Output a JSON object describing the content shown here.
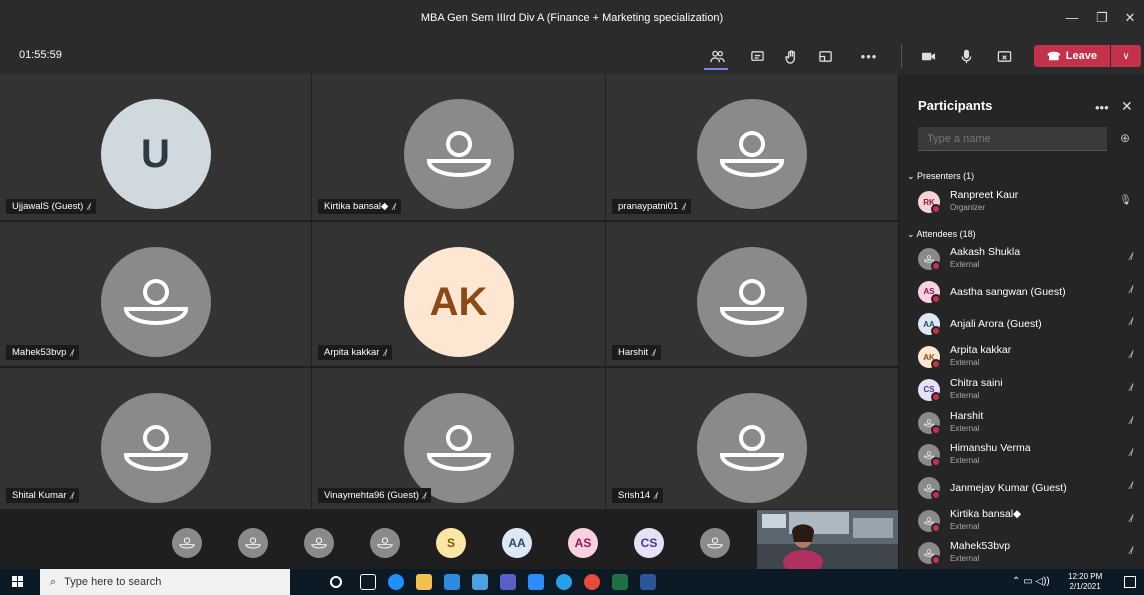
{
  "window": {
    "title": "MBA Gen Sem IIIrd Div A (Finance + Marketing specialization)"
  },
  "toolbar": {
    "timer": "01:55:59",
    "leave_label": "Leave"
  },
  "tiles": [
    {
      "name": "UjjawalS (Guest)",
      "initials": "U",
      "bg": "#cfd9de",
      "fg": "#2b3a44"
    },
    {
      "name": "Kirtika bansal◆",
      "initials": "",
      "bg": "",
      "fg": ""
    },
    {
      "name": "pranaypatni01",
      "initials": "",
      "bg": "",
      "fg": ""
    },
    {
      "name": "Mahek53bvp",
      "initials": "",
      "bg": "",
      "fg": ""
    },
    {
      "name": "Arpita kakkar",
      "initials": "AK",
      "bg": "#fde7d2",
      "fg": "#8a4a17"
    },
    {
      "name": "Harshit",
      "initials": "",
      "bg": "",
      "fg": ""
    },
    {
      "name": "Shital Kumar",
      "initials": "",
      "bg": "",
      "fg": ""
    },
    {
      "name": "Vinaymehta96 (Guest)",
      "initials": "",
      "bg": "",
      "fg": ""
    },
    {
      "name": "Srish14",
      "initials": "",
      "bg": "",
      "fg": ""
    }
  ],
  "tray": [
    {
      "initials": "",
      "bg": "",
      "fg": ""
    },
    {
      "initials": "",
      "bg": "",
      "fg": ""
    },
    {
      "initials": "",
      "bg": "",
      "fg": ""
    },
    {
      "initials": "",
      "bg": "",
      "fg": ""
    },
    {
      "initials": "S",
      "bg": "#fce6a6",
      "fg": "#7a5a00"
    },
    {
      "initials": "AA",
      "bg": "#dce9f5",
      "fg": "#2c4a6b"
    },
    {
      "initials": "AS",
      "bg": "#fad1e3",
      "fg": "#8a1e4e"
    },
    {
      "initials": "CS",
      "bg": "#e6e1f5",
      "fg": "#4a3a8a"
    },
    {
      "initials": "",
      "bg": "",
      "fg": ""
    }
  ],
  "panel": {
    "title": "Participants",
    "search_placeholder": "Type a name",
    "presenters_label": "Presenters (1)",
    "attendees_label": "Attendees (18)",
    "presenters": [
      {
        "name": "Ranpreet Kaur",
        "sub": "Organizer",
        "initials": "RK",
        "bg": "#fad1d8",
        "fg": "#8a1e2e"
      }
    ],
    "attendees": [
      {
        "name": "Aakash Shukla",
        "sub": "External",
        "initials": "",
        "bg": "",
        "fg": ""
      },
      {
        "name": "Aastha sangwan (Guest)",
        "sub": "",
        "initials": "AS",
        "bg": "#fad1e3",
        "fg": "#8a1e4e"
      },
      {
        "name": "Anjali Arora (Guest)",
        "sub": "",
        "initials": "AA",
        "bg": "#dce9f5",
        "fg": "#2c4a6b"
      },
      {
        "name": "Arpita kakkar",
        "sub": "External",
        "initials": "AK",
        "bg": "#fde7d2",
        "fg": "#8a4a17"
      },
      {
        "name": "Chitra saini",
        "sub": "External",
        "initials": "CS",
        "bg": "#e6e1f5",
        "fg": "#4a3a8a"
      },
      {
        "name": "Harshit",
        "sub": "External",
        "initials": "",
        "bg": "",
        "fg": ""
      },
      {
        "name": "Himanshu Verma",
        "sub": "External",
        "initials": "",
        "bg": "",
        "fg": ""
      },
      {
        "name": "Janmejay Kumar (Guest)",
        "sub": "",
        "initials": "",
        "bg": "",
        "fg": ""
      },
      {
        "name": "Kirtika bansal◆",
        "sub": "External",
        "initials": "",
        "bg": "",
        "fg": ""
      },
      {
        "name": "Mahek53bvp",
        "sub": "External",
        "initials": "",
        "bg": "",
        "fg": ""
      }
    ]
  },
  "taskbar": {
    "search_placeholder": "Type here to search",
    "time": "12:20 PM",
    "date": "2/1/2021"
  },
  "colors": {
    "leave": "#c4314b",
    "tile": "#333333",
    "panel": "#252525"
  }
}
